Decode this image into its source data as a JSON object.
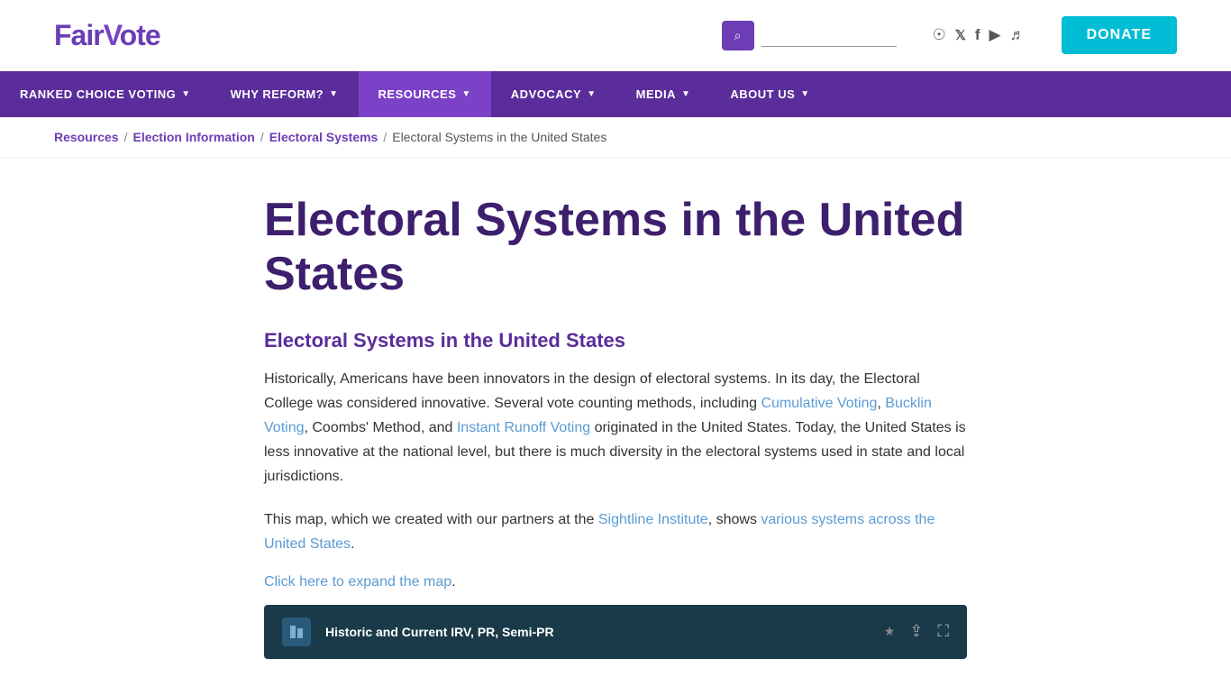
{
  "header": {
    "logo_text": "Fair",
    "logo_v": "V",
    "logo_rest": "ote",
    "search_placeholder": "",
    "donate_label": "DONATE"
  },
  "social": {
    "rss_icon": "⊞",
    "twitter_icon": "𝕏",
    "facebook_icon": "f",
    "youtube_icon": "▶",
    "soundcloud_icon": "☁"
  },
  "nav": {
    "items": [
      {
        "label": "RANKED CHOICE VOTING",
        "has_arrow": true,
        "active": false
      },
      {
        "label": "WHY REFORM?",
        "has_arrow": true,
        "active": false
      },
      {
        "label": "RESOURCES",
        "has_arrow": true,
        "active": true
      },
      {
        "label": "ADVOCACY",
        "has_arrow": true,
        "active": false
      },
      {
        "label": "MEDIA",
        "has_arrow": true,
        "active": false
      },
      {
        "label": "ABOUT US",
        "has_arrow": true,
        "active": false
      }
    ]
  },
  "breadcrumb": {
    "crumbs": [
      {
        "label": "Resources",
        "link": true
      },
      {
        "label": "Election Information",
        "link": true
      },
      {
        "label": "Electoral Systems",
        "link": true
      },
      {
        "label": "Electoral Systems in the United States",
        "link": false
      }
    ]
  },
  "page": {
    "title": "Electoral Systems in the United States",
    "subtitle": "Electoral Systems in the United States",
    "paragraph1_before": "Historically, Americans have been innovators in the design of electoral systems. In its day, the Electoral College was considered innovative. Several vote counting methods, including ",
    "link_cumulative": "Cumulative Voting",
    "paragraph1_mid1": ", ",
    "link_bucklin": "Bucklin Voting",
    "paragraph1_mid2": ", Coombs' Method, and ",
    "link_irv": "Instant Runoff Voting",
    "paragraph1_after": " originated in the United States. Today, the United States is less innovative at the national level, but there is much diversity in the electoral systems used in state and local jurisdictions.",
    "paragraph2_before": "This map, which we created with our partners at the ",
    "link_sightline": "Sightline Institute",
    "paragraph2_mid": ", shows ",
    "link_various": "various systems across the United States",
    "paragraph2_after": ".",
    "click_expand": "Click here to expand the map",
    "click_expand_period": ".",
    "map_title": "Historic and Current IRV, PR, Semi-PR",
    "map_star": "★"
  }
}
